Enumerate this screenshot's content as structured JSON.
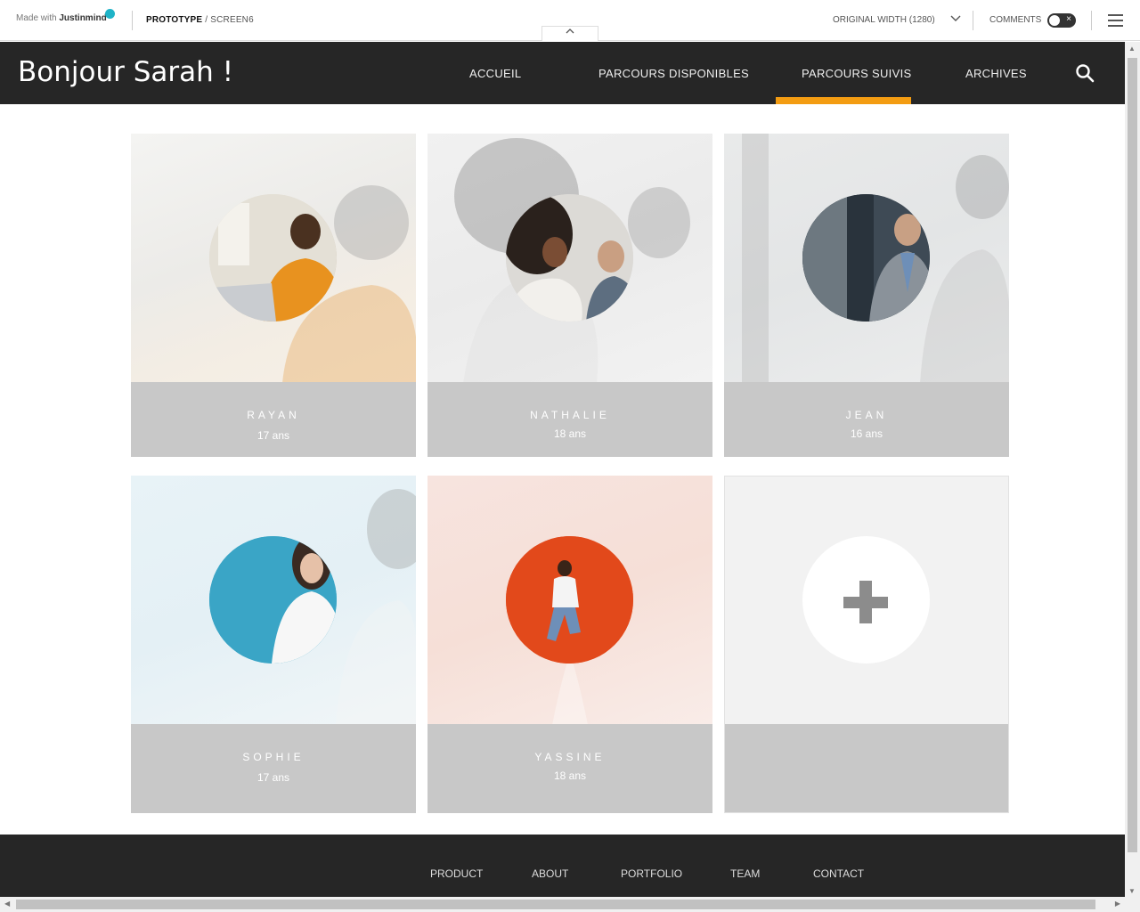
{
  "toolbar": {
    "logo_prefix": "Made with",
    "logo_brand": "Justinmind",
    "breadcrumb_project": "PROTOTYPE",
    "breadcrumb_sep": " / ",
    "breadcrumb_screen": "SCREEN6",
    "width_label": "ORIGINAL WIDTH (1280)",
    "comments_label": "COMMENTS",
    "comments_enabled": false
  },
  "header": {
    "greeting": "Bonjour Sarah !",
    "nav": [
      {
        "label": "ACCUEIL",
        "active": false
      },
      {
        "label": "PARCOURS DISPONIBLES",
        "active": false
      },
      {
        "label": "PARCOURS SUIVIS",
        "active": true
      },
      {
        "label": "ARCHIVES",
        "active": false
      }
    ],
    "accent_color": "#f39c12",
    "background_color": "#262626"
  },
  "profiles": [
    {
      "name": "RAYAN",
      "age": "17 ans"
    },
    {
      "name": "NATHALIE",
      "age": "18 ans"
    },
    {
      "name": "JEAN",
      "age": "16 ans"
    },
    {
      "name": "SOPHIE",
      "age": "17 ans"
    },
    {
      "name": "YASSINE",
      "age": "18 ans"
    }
  ],
  "footer": {
    "links": [
      "PRODUCT",
      "ABOUT",
      "PORTFOLIO",
      "TEAM",
      "CONTACT"
    ]
  }
}
